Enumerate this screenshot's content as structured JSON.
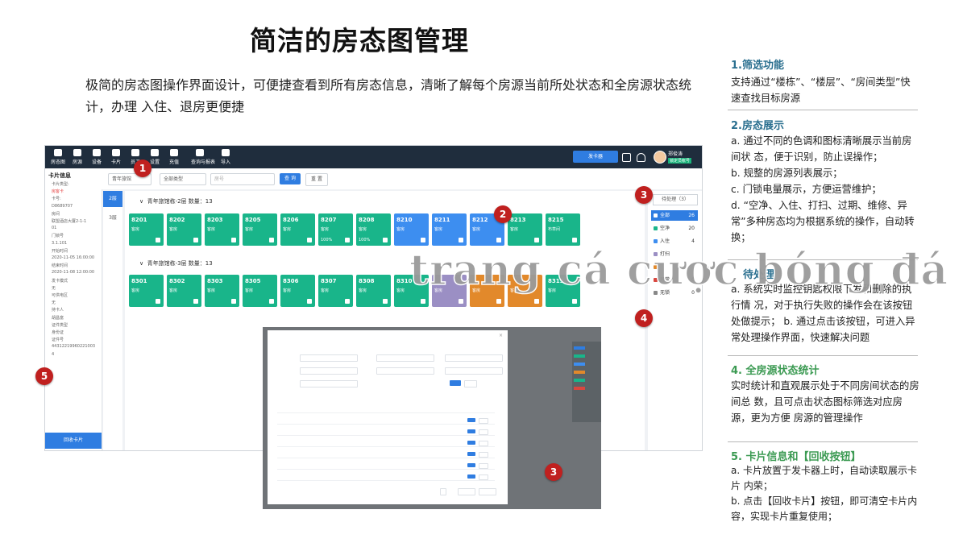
{
  "slide": {
    "title": "简洁的房态图管理",
    "intro": "极简的房态图操作界面设计，可便捷查看到所有房态信息，清晰了解每个房源当前所处状态和全房源状态统计，办理 入住、退房更便捷"
  },
  "app": {
    "nav": [
      {
        "label": "房态图",
        "icon": "building-icon"
      },
      {
        "label": "房源",
        "icon": "home-icon"
      },
      {
        "label": "设备",
        "icon": "lock-icon"
      },
      {
        "label": "卡片",
        "icon": "card-icon"
      },
      {
        "label": "员工",
        "icon": "user-icon"
      },
      {
        "label": "设置",
        "icon": "gear-icon"
      },
      {
        "label": "充值",
        "icon": "yen-icon"
      },
      {
        "label": "查询与报表",
        "icon": "report-icon"
      },
      {
        "label": "导入",
        "icon": "import-icon"
      }
    ],
    "issue_button": "发卡器",
    "user": {
      "name": "郑俊涛",
      "role": "锁定员帐号"
    },
    "card_panel": {
      "title": "卡片信息",
      "lines": [
        {
          "text": "卡片类型:",
          "red": false
        },
        {
          "text": "房客卡",
          "red": true
        },
        {
          "text": "卡号:",
          "red": false
        },
        {
          "text": "D8689707",
          "red": false
        },
        {
          "text": "房间",
          "red": false
        },
        {
          "text": "联盟酒店大厦2-1-1",
          "red": false
        },
        {
          "text": "01",
          "red": false
        },
        {
          "text": "门锁号",
          "red": false
        },
        {
          "text": "3.1.101",
          "red": false
        },
        {
          "text": "开始时间",
          "red": false
        },
        {
          "text": "2020-11-05 16:00:00",
          "red": false
        },
        {
          "text": "结束时间",
          "red": false
        },
        {
          "text": "2020-11-08 12:00:00",
          "red": false
        },
        {
          "text": "发卡模式",
          "red": false
        },
        {
          "text": "无",
          "red": false
        },
        {
          "text": "可供电区",
          "red": false
        },
        {
          "text": "无",
          "red": false
        },
        {
          "text": "持卡人",
          "red": false
        },
        {
          "text": "胡昌富",
          "red": false
        },
        {
          "text": "证件类型",
          "red": false
        },
        {
          "text": "身份证",
          "red": false
        },
        {
          "text": "证件号",
          "red": false
        },
        {
          "text": "44312219960221003",
          "red": false
        },
        {
          "text": "4",
          "red": false
        }
      ],
      "recycle_button": "回收卡片"
    },
    "filters": {
      "building": "青年旅馆",
      "type": "全部类型",
      "room_placeholder": "房号",
      "search_button": "查 询",
      "reset_button": "重 置"
    },
    "floors": [
      "2层",
      "3层"
    ],
    "groups": [
      {
        "header": "青年旅馆栋-2层 数量：13",
        "rooms": [
          {
            "no": "8201",
            "status": "客房",
            "color": "#19b58a",
            "battery": ""
          },
          {
            "no": "8202",
            "status": "客房",
            "color": "#19b58a",
            "battery": ""
          },
          {
            "no": "8203",
            "status": "客房",
            "color": "#19b58a",
            "battery": ""
          },
          {
            "no": "8205",
            "status": "客房",
            "color": "#19b58a",
            "battery": ""
          },
          {
            "no": "8206",
            "status": "客房",
            "color": "#19b58a",
            "battery": ""
          },
          {
            "no": "8207",
            "status": "客房",
            "color": "#19b58a",
            "battery": "100%"
          },
          {
            "no": "8208",
            "status": "客房",
            "color": "#19b58a",
            "battery": "100%"
          },
          {
            "no": "8210",
            "status": "客房",
            "color": "#3d8ef0",
            "battery": ""
          },
          {
            "no": "8211",
            "status": "客房",
            "color": "#3d8ef0",
            "battery": ""
          },
          {
            "no": "8212",
            "status": "客房",
            "color": "#3d8ef0",
            "battery": ""
          },
          {
            "no": "8213",
            "status": "客房",
            "color": "#19b58a",
            "battery": ""
          },
          {
            "no": "8215",
            "status": "布草间",
            "color": "#19b58a",
            "battery": ""
          }
        ]
      },
      {
        "header": "青年旅馆栋-3层 数量：13",
        "rooms": [
          {
            "no": "8301",
            "status": "客房",
            "color": "#19b58a",
            "battery": ""
          },
          {
            "no": "8302",
            "status": "客房",
            "color": "#19b58a",
            "battery": ""
          },
          {
            "no": "8303",
            "status": "客房",
            "color": "#19b58a",
            "battery": ""
          },
          {
            "no": "8305",
            "status": "客房",
            "color": "#19b58a",
            "battery": ""
          },
          {
            "no": "8306",
            "status": "客房",
            "color": "#19b58a",
            "battery": ""
          },
          {
            "no": "8307",
            "status": "客房",
            "color": "#19b58a",
            "battery": ""
          },
          {
            "no": "8308",
            "status": "客房",
            "color": "#19b58a",
            "battery": ""
          },
          {
            "no": "8310",
            "status": "客房",
            "color": "#19b58a",
            "battery": ""
          },
          {
            "no": "",
            "status": "客房",
            "color": "#9b8fc4",
            "battery": ""
          },
          {
            "no": "",
            "status": "客房",
            "color": "#e2892b",
            "battery": ""
          },
          {
            "no": "",
            "status": "客房",
            "color": "#e2892b",
            "battery": ""
          },
          {
            "no": "8315",
            "status": "客房",
            "color": "#19b58a",
            "battery": ""
          }
        ]
      }
    ],
    "pending": "待处理（3）",
    "stats": [
      {
        "label": "全部",
        "count": "26",
        "color": "#2f7de1",
        "active": true
      },
      {
        "label": "空净",
        "count": "20",
        "color": "#19b58a",
        "active": false
      },
      {
        "label": "入住",
        "count": "4",
        "color": "#3d8ef0",
        "active": false
      },
      {
        "label": "打扫",
        "count": "",
        "color": "#9b8fc4",
        "active": false
      },
      {
        "label": "",
        "count": "",
        "color": "#e2892b",
        "active": false
      },
      {
        "label": "异常",
        "count": "0",
        "color": "#d9473f",
        "active": false
      },
      {
        "label": "无锁",
        "count": "0",
        "color": "#888888",
        "active": false
      }
    ]
  },
  "markers": [
    "1",
    "2",
    "3",
    "4",
    "5",
    "3"
  ],
  "watermark": "trang cá cược bóng đá",
  "sections": [
    {
      "title": "1.筛选功能",
      "text": "支持通过“楼栋”、“楼层”、“房间类型”快 速查找目标房源"
    },
    {
      "title": "2.房态展示",
      "text": "a. 通过不同的色调和图标清晰展示当前房间状 态，便于识别，防止误操作；\nb. 规整的房源列表展示；\nc. 门锁电量展示，方便运营维护；\nd. “空净、入住、打扫、过期、维修、异常”多种房态均为根据系统的操作，自动转换；"
    },
    {
      "title": "待处理",
      "text": "a. 系统实时监控钥匙权限下发和删除的执行情 况，对于执行失败的操作会在该按钮处做提示； b. 通过点击该按钮，可进入异常处理操作界面，快速解决问题"
    },
    {
      "title": "4. 全房源状态统计",
      "text": "实时统计和直观展示处于不同房间状态的房间总 数，且可点击状态图标筛选对应房源，更为方便 房源的管理操作"
    },
    {
      "title": "5. 卡片信息和【回收按钮】",
      "text": "a. 卡片放置于发卡器上时，自动读取展示卡片 内荣；\nb. 点击【回收卡片】按钮，即可清空卡片内 容，实现卡片重复使用；"
    }
  ]
}
